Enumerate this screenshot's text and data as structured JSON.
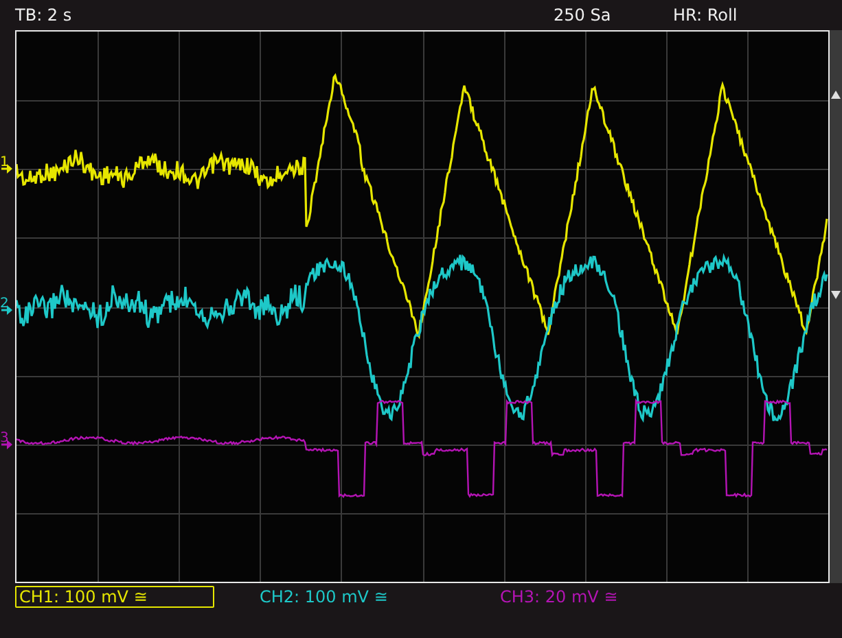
{
  "status_bar": {
    "timebase": "TB: 2 s",
    "samples": "250 Sa",
    "mode": "HR: Roll"
  },
  "channels": [
    {
      "marker": "1",
      "readout": "CH1: 100 mV ≅",
      "color": "#e6e600",
      "selected": true
    },
    {
      "marker": "2",
      "readout": "CH2: 100 mV ≅",
      "color": "#1ec8c8",
      "selected": false
    },
    {
      "marker": "3",
      "readout": "CH3: 20 mV ≅",
      "color": "#b414b4",
      "selected": false
    }
  ]
}
